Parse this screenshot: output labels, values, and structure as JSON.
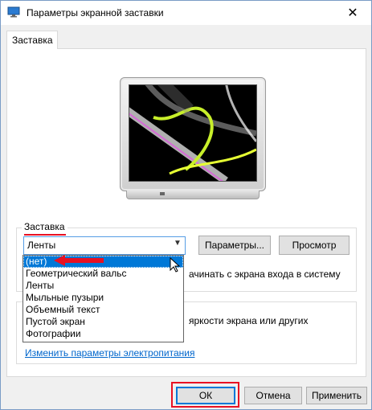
{
  "window": {
    "title": "Параметры экранной заставки",
    "close_glyph": "✕"
  },
  "tab": {
    "label": "Заставка"
  },
  "screensaver_group": {
    "label": "Заставка",
    "selected": "Ленты",
    "params_button": "Параметры...",
    "preview_button": "Просмотр",
    "resume_text": "ачинать с экрана входа в систему"
  },
  "dropdown": {
    "options": [
      "(нет)",
      "Геометрический вальс",
      "Ленты",
      "Мыльные пузыри",
      "Объемный текст",
      "Пустой экран",
      "Фотографии"
    ]
  },
  "power_group": {
    "text": "яркости экрана или других",
    "link": "Изменить параметры электропитания"
  },
  "footer": {
    "ok": "ОК",
    "cancel": "Отмена",
    "apply": "Применить"
  },
  "colors": {
    "accent": "#0078d7",
    "highlight_red": "#e81123",
    "link": "#0066cc"
  }
}
